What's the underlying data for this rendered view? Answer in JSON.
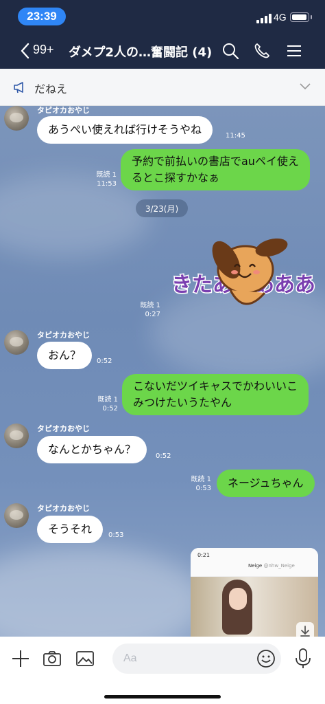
{
  "status_bar": {
    "time": "23:39",
    "network": "4G"
  },
  "header": {
    "unread_count": "99+",
    "title": "ダメプ2人の…奮闘記 (4)"
  },
  "announcement": {
    "text": "だねえ"
  },
  "chat": {
    "sender_name": "タピオカおやじ",
    "messages": [
      {
        "text": "あうぺい使えれば行けそうやね",
        "time": "11:45"
      },
      {
        "line1": "予約で前払いの書店でauペイ使え",
        "line2": "るとこ探すかなぁ",
        "read": "既読 1",
        "time": "11:53"
      },
      {
        "date": "3/23(月)"
      },
      {
        "sticker_text": "きたあああああ",
        "read": "既読 1",
        "time": "0:27"
      },
      {
        "text": "おん？",
        "time": "0:52"
      },
      {
        "line1": "こないだツイキャスでかわいいこ",
        "line2": "みつけたいうたやん",
        "read": "既読 1",
        "time": "0:52"
      },
      {
        "text": "なんとかちゃん？",
        "time": "0:52"
      },
      {
        "text": "ネージュちゃん",
        "read": "既読 1",
        "time": "0:53"
      },
      {
        "text": "そうそれ",
        "time": "0:53"
      },
      {
        "media_time": "0:21",
        "media_name": "Neige",
        "media_handle": "@nhw_Neige"
      }
    ]
  },
  "input": {
    "placeholder": "Aa"
  },
  "colors": {
    "header_bg": "#1f2a44",
    "outgoing_bubble": "#6cd64a",
    "incoming_bubble": "#ffffff",
    "time_pill": "#2f86f6"
  }
}
